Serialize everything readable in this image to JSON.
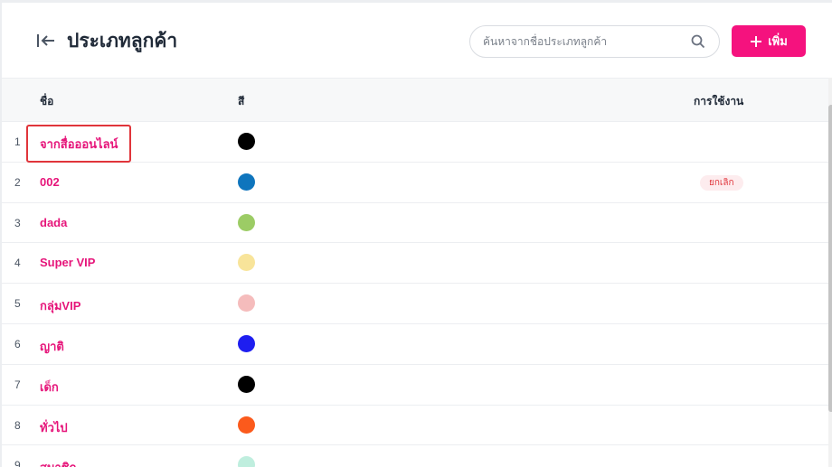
{
  "header": {
    "title": "ประเภทลูกค้า",
    "search_placeholder": "ค้นหาจากชื่อประเภทลูกค้า",
    "add_label": "เพิ่ม"
  },
  "table": {
    "columns": {
      "name": "ชื่อ",
      "color": "สี",
      "usage": "การใช้งาน"
    },
    "rows": [
      {
        "index": "1",
        "name": "จากสื่อออนไลน์",
        "color": "#000000",
        "status": ""
      },
      {
        "index": "2",
        "name": "002",
        "color": "#0f75bd",
        "status": "ยกเลิก"
      },
      {
        "index": "3",
        "name": "dada",
        "color": "#9ccc65",
        "status": ""
      },
      {
        "index": "4",
        "name": "Super VIP",
        "color": "#f8e49a",
        "status": ""
      },
      {
        "index": "5",
        "name": "กลุ่มVIP",
        "color": "#f5bcbc",
        "status": ""
      },
      {
        "index": "6",
        "name": "ญาติ",
        "color": "#1e1ef0",
        "status": ""
      },
      {
        "index": "7",
        "name": "เด็ก",
        "color": "#000000",
        "status": ""
      },
      {
        "index": "8",
        "name": "ทั่วไป",
        "color": "#fb5a1c",
        "status": ""
      },
      {
        "index": "9",
        "name": "สมาชิก",
        "color": "#bfeede",
        "status": ""
      }
    ]
  },
  "theme": {
    "accent": "#f5127e",
    "link": "#e6157a",
    "cancel_badge": "#e0353b"
  },
  "icons": {
    "back": "collapse-left-icon",
    "search": "search-icon",
    "add": "plus-icon"
  }
}
